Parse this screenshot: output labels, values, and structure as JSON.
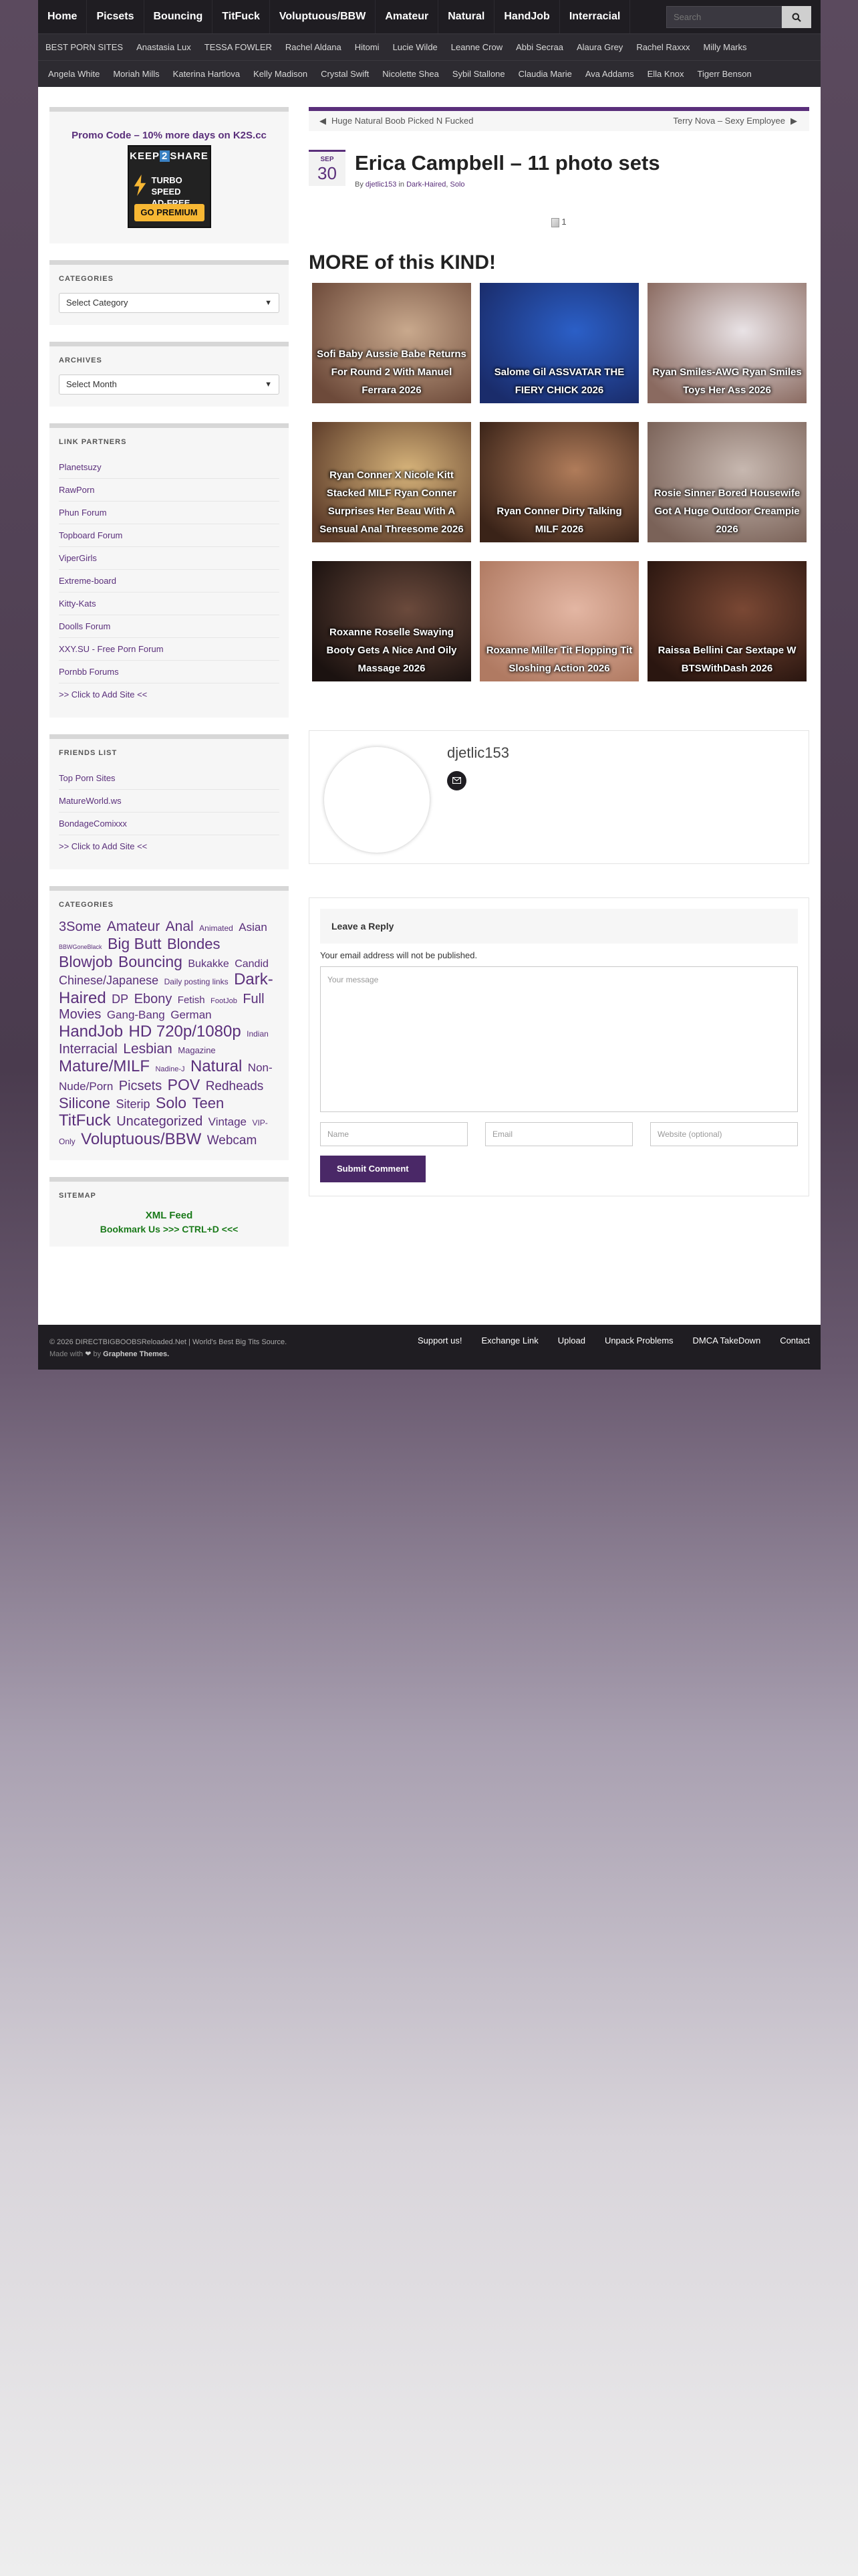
{
  "topnav": {
    "items": [
      "Home",
      "Picsets",
      "Bouncing",
      "TitFuck",
      "Voluptuous/BBW",
      "Amateur",
      "Natural",
      "HandJob",
      "Interracial"
    ],
    "search_placeholder": "Search"
  },
  "subnav": {
    "row1": [
      "BEST PORN SITES",
      "Anastasia Lux",
      "TESSA FOWLER",
      "Rachel Aldana",
      "Hitomi",
      "Lucie Wilde",
      "Leanne Crow",
      "Abbi Secraa",
      "Alaura Grey",
      "Rachel Raxxx",
      "Milly Marks"
    ],
    "row2": [
      "Angela White",
      "Moriah Mills",
      "Katerina Hartlova",
      "Kelly Madison",
      "Crystal Swift",
      "Nicolette Shea",
      "Sybil Stallone",
      "Claudia Marie",
      "Ava Addams",
      "Ella Knox",
      "Tigerr Benson"
    ]
  },
  "sidebar": {
    "promo": {
      "link": "Promo Code – 10% more days on K2S.cc",
      "banner_top_a": "KEEP",
      "banner_top_b": "2",
      "banner_top_c": "SHARE",
      "banner_line1": "TURBO SPEED",
      "banner_line2": "AD-FREE",
      "banner_button": "GO PREMIUM"
    },
    "categories_title": "CATEGORIES",
    "categories_select": "Select Category",
    "archives_title": "ARCHIVES",
    "archives_select": "Select Month",
    "link_partners_title": "LINK PARTNERS",
    "link_partners": [
      "Planetsuzy",
      "RawPorn",
      "Phun Forum",
      "Topboard Forum",
      "ViperGirls",
      "Extreme-board",
      "Kitty-Kats",
      "Doolls Forum",
      "XXY.SU - Free Porn Forum",
      "Pornbb Forums",
      ">> Click to Add Site <<"
    ],
    "friends_title": "FRIENDS LIST",
    "friends": [
      "Top Porn Sites",
      "MatureWorld.ws",
      "BondageComixxx",
      ">> Click to Add Site <<"
    ],
    "tagcloud_title": "CATEGORIES",
    "tags": [
      {
        "t": "3Some",
        "s": 20
      },
      {
        "t": "Amateur",
        "s": 21
      },
      {
        "t": "Anal",
        "s": 21
      },
      {
        "t": "Animated",
        "s": 12
      },
      {
        "t": "Asian",
        "s": 17
      },
      {
        "t": "BBWGoneBlack",
        "s": 9
      },
      {
        "t": "Big Butt",
        "s": 23
      },
      {
        "t": "Blondes",
        "s": 22
      },
      {
        "t": "Blowjob",
        "s": 23
      },
      {
        "t": "Bouncing",
        "s": 23
      },
      {
        "t": "Bukakke",
        "s": 16
      },
      {
        "t": "Candid",
        "s": 16
      },
      {
        "t": "Chinese/Japanese",
        "s": 18
      },
      {
        "t": "Daily posting links",
        "s": 12
      },
      {
        "t": "Dark-Haired",
        "s": 24
      },
      {
        "t": "DP",
        "s": 18
      },
      {
        "t": "Ebony",
        "s": 20
      },
      {
        "t": "Fetish",
        "s": 15
      },
      {
        "t": "FootJob",
        "s": 11
      },
      {
        "t": "Full Movies",
        "s": 20
      },
      {
        "t": "Gang-Bang",
        "s": 17
      },
      {
        "t": "German",
        "s": 17
      },
      {
        "t": "HandJob",
        "s": 24
      },
      {
        "t": "HD 720p/1080p",
        "s": 24
      },
      {
        "t": "Indian",
        "s": 12
      },
      {
        "t": "Interracial",
        "s": 20
      },
      {
        "t": "Lesbian",
        "s": 21
      },
      {
        "t": "Magazine",
        "s": 13
      },
      {
        "t": "Mature/MILF",
        "s": 24
      },
      {
        "t": "Nadine-J",
        "s": 11
      },
      {
        "t": "Natural",
        "s": 24
      },
      {
        "t": "Non-Nude/Porn",
        "s": 17
      },
      {
        "t": "Picsets",
        "s": 20
      },
      {
        "t": "POV",
        "s": 23
      },
      {
        "t": "Redheads",
        "s": 19
      },
      {
        "t": "Silicone",
        "s": 22
      },
      {
        "t": "Siterip",
        "s": 18
      },
      {
        "t": "Solo",
        "s": 23
      },
      {
        "t": "Teen",
        "s": 22
      },
      {
        "t": "TitFuck",
        "s": 24
      },
      {
        "t": "Uncategorized",
        "s": 20
      },
      {
        "t": "Vintage",
        "s": 17
      },
      {
        "t": "VIP-Only",
        "s": 12
      },
      {
        "t": "Voluptuous/BBW",
        "s": 24
      },
      {
        "t": "Webcam",
        "s": 19
      }
    ],
    "sitemap_title": "SITEMAP",
    "sitemap_xml": "XML Feed",
    "sitemap_bookmark": "Bookmark Us >>> CTRL+D <<<"
  },
  "main": {
    "prev_post": "Huge Natural Boob Picked N Fucked",
    "next_post": "Terry Nova – Sexy Employee",
    "date_month": "SEP",
    "date_day": "30",
    "title": "Erica Campbell – 11 photo sets",
    "meta_by": "By",
    "meta_author": "djetlic153",
    "meta_in": "in",
    "meta_cat1": "Dark-Haired",
    "meta_cat2": "Solo",
    "broken_image_alt": "1",
    "more_heading": "MORE of this KIND!",
    "related": [
      {
        "caption": "Sofi Baby Aussie Babe Returns For Round 2 With Manuel Ferrara 2026",
        "c1": "#c9a98d",
        "c2": "#6d4a3a"
      },
      {
        "caption": "Salome Gil ASSVATAR THE FIERY CHICK 2026",
        "c1": "#2b5fc7",
        "c2": "#1a2c6b"
      },
      {
        "caption": "Ryan Smiles-AWG Ryan Smiles Toys Her Ass 2026",
        "c1": "#e9e3e6",
        "c2": "#8a6a60"
      },
      {
        "caption": "Ryan Conner X Nicole Kitt Stacked MILF Ryan Conner Surprises Her Beau With A Sensual Anal Threesome 2026",
        "c1": "#d6b37a",
        "c2": "#5e3d2a"
      },
      {
        "caption": "Ryan Conner Dirty Talking MILF 2026",
        "c1": "#b07c5a",
        "c2": "#3a2318"
      },
      {
        "caption": "Rosie Sinner Bored Housewife Got A Huge Outdoor Creampie 2026",
        "c1": "#c7b8b0",
        "c2": "#7a6258"
      },
      {
        "caption": "Roxanne Roselle Swaying Booty Gets A Nice And Oily Massage 2026",
        "c1": "#6b4a3c",
        "c2": "#1b1210"
      },
      {
        "caption": "Roxanne Miller Tit Flopping Tit Sloshing Action 2026",
        "c1": "#e3b6a3",
        "c2": "#b07a62"
      },
      {
        "caption": "Raissa Bellini Car Sextape W BTSWithDash 2026",
        "c1": "#7a4834",
        "c2": "#2a1610"
      }
    ],
    "author_name": "djetlic153",
    "reply_title": "Leave a Reply",
    "reply_note": "Your email address will not be published.",
    "message_placeholder": "Your message",
    "name_placeholder": "Name",
    "email_placeholder": "Email",
    "website_placeholder": "Website (optional)",
    "submit_label": "Submit Comment"
  },
  "footer": {
    "copyright": "© 2026 DIRECTBIGBOOBSReloaded.Net | World's Best Big Tits Source.",
    "made_with": "Made with",
    "heart": "❤",
    "by": "by",
    "theme": "Graphene Themes.",
    "links": [
      "Support us!",
      "Exchange Link",
      "Upload",
      "Unpack Problems",
      "DMCA TakeDown",
      "Contact"
    ]
  },
  "colors": {
    "accent": "#5a2f7b",
    "nav_bg": "#1f1d22",
    "submit": "#4a2867",
    "sitemap": "#1a7a1a"
  }
}
